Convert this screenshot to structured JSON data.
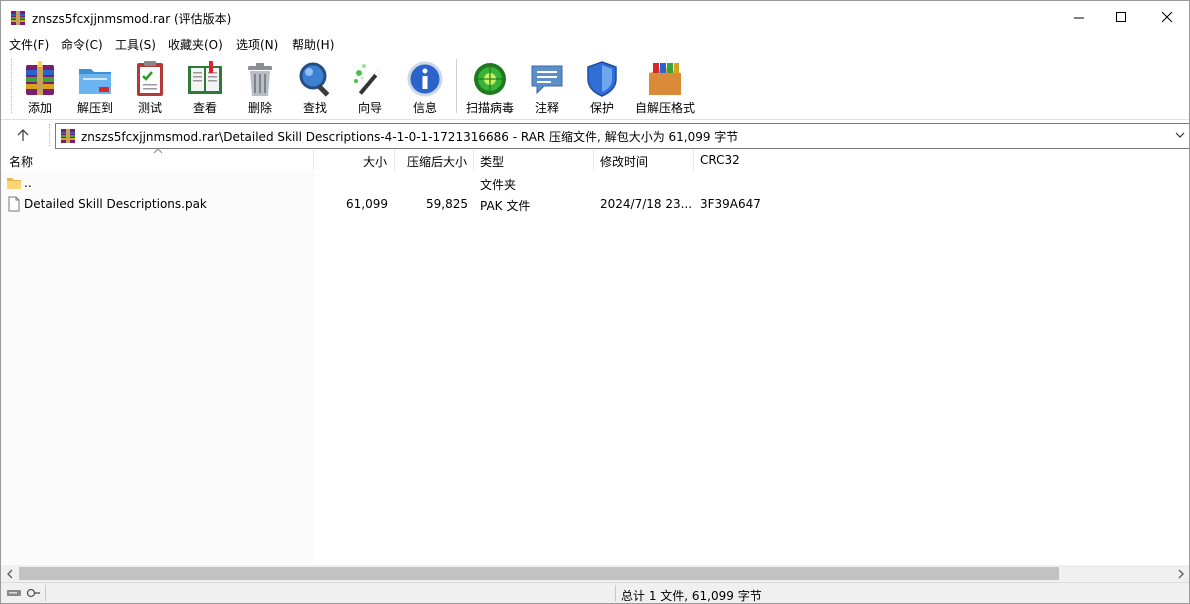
{
  "window": {
    "title": "znszs5fcxjjnmsmod.rar (评估版本)",
    "icon": "winrar-icon"
  },
  "menubar": {
    "items": [
      "文件(F)",
      "命令(C)",
      "工具(S)",
      "收藏夹(O)",
      "选项(N)",
      "帮助(H)"
    ]
  },
  "toolbar": {
    "buttons": [
      {
        "label": "添加",
        "icon": "add-archive-icon"
      },
      {
        "label": "解压到",
        "icon": "extract-folder-icon"
      },
      {
        "label": "测试",
        "icon": "test-clipboard-icon"
      },
      {
        "label": "查看",
        "icon": "view-book-icon"
      },
      {
        "label": "删除",
        "icon": "trash-icon"
      },
      {
        "label": "查找",
        "icon": "magnifier-icon"
      },
      {
        "label": "向导",
        "icon": "wizard-wand-icon"
      },
      {
        "label": "信息",
        "icon": "info-icon"
      },
      {
        "label": "扫描病毒",
        "icon": "virus-scan-icon"
      },
      {
        "label": "注释",
        "icon": "comment-icon"
      },
      {
        "label": "保护",
        "icon": "shield-icon"
      },
      {
        "label": "自解压格式",
        "icon": "sfx-box-icon"
      }
    ]
  },
  "address": {
    "path": "znszs5fcxjjnmsmod.rar\\Detailed Skill Descriptions-4-1-0-1-1721316686 - RAR 压缩文件, 解包大小为 61,099 字节"
  },
  "columns": {
    "name": "名称",
    "size": "大小",
    "packed": "压缩后大小",
    "type": "类型",
    "modified": "修改时间",
    "crc": "CRC32"
  },
  "rows": [
    {
      "name": "..",
      "size": "",
      "packed": "",
      "type": "文件夹",
      "modified": "",
      "crc": "",
      "icon": "folder-icon"
    },
    {
      "name": "Detailed Skill Descriptions.pak",
      "size": "61,099",
      "packed": "59,825",
      "type": "PAK 文件",
      "modified": "2024/7/18 23...",
      "crc": "3F39A647",
      "icon": "file-icon"
    }
  ],
  "status": {
    "summary": "总计 1 文件, 61,099 字节"
  },
  "colors": {
    "accent": "#0078d7",
    "scroll_thumb": "#c2c2c2"
  }
}
